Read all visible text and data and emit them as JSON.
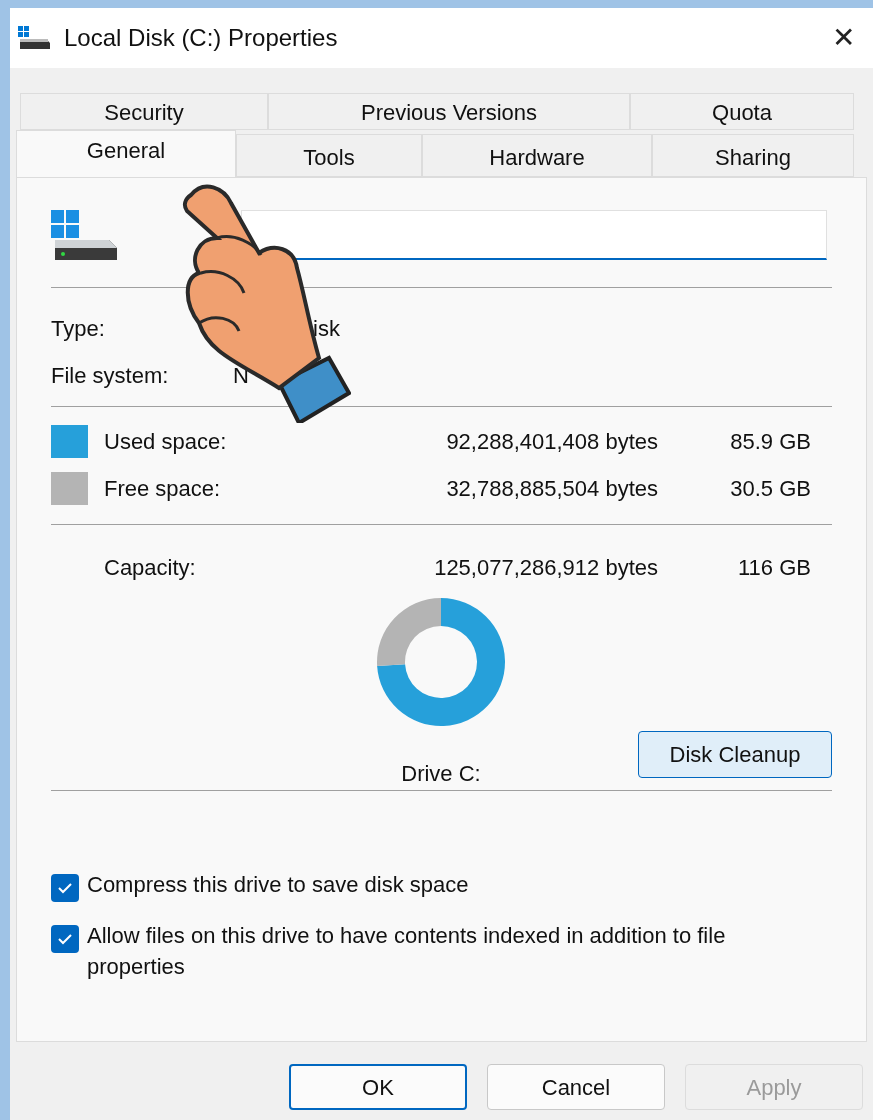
{
  "window": {
    "title": "Local Disk (C:) Properties",
    "close": "✕"
  },
  "tabs": [
    [
      {
        "label": "Security",
        "selected": false
      },
      {
        "label": "Previous Versions",
        "selected": false
      },
      {
        "label": "Quota",
        "selected": false
      }
    ],
    [
      {
        "label": "General",
        "selected": true
      },
      {
        "label": "Tools",
        "selected": false
      },
      {
        "label": "Hardware",
        "selected": false
      },
      {
        "label": "Sharing",
        "selected": false
      }
    ]
  ],
  "properties": [
    {
      "label": "Type:",
      "value": "isk"
    },
    {
      "label": "File system:",
      "value": "N"
    }
  ],
  "space": [
    {
      "label": "Used space:",
      "bytes": "92,288,401,408 bytes",
      "size": "85.9 GB",
      "color": "#26a0da"
    },
    {
      "label": "Free space:",
      "bytes": "32,788,885,504 bytes",
      "size": "30.5 GB",
      "color": "#b4b4b4"
    }
  ],
  "capacity": {
    "label": "Capacity:",
    "bytes": "125,077,286,912 bytes",
    "size": "116 GB"
  },
  "chart_data": {
    "type": "donut",
    "series": [
      {
        "name": "Drive C:",
        "values": [
          74,
          26
        ]
      }
    ]
  },
  "cleanup_button": "Disk Cleanup",
  "options": [
    {
      "label": "Compress this drive to save disk space",
      "checked": true
    },
    {
      "label": "Allow files on this drive to have contents indexed in addition to file properties",
      "checked": true
    }
  ],
  "buttons": [
    {
      "label": "OK",
      "kind": "default",
      "disabled": false
    },
    {
      "label": "Cancel",
      "kind": "normal",
      "disabled": false
    },
    {
      "label": "Apply",
      "kind": "normal",
      "disabled": true
    }
  ]
}
